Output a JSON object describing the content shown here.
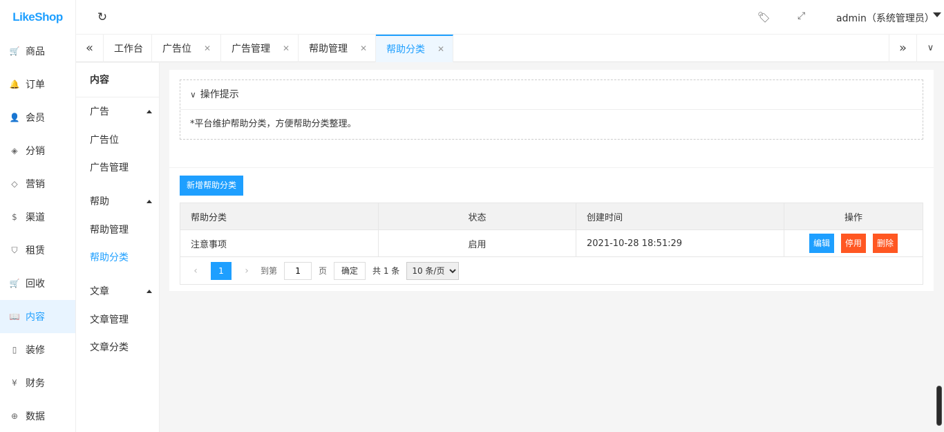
{
  "app": {
    "logo": "LikeShop"
  },
  "header": {
    "refresh_icon": "refresh-icon",
    "user_label": "admin（系统管理员）"
  },
  "nav": {
    "items": [
      {
        "label": "商品",
        "icon": "cart-icon",
        "glyph": "🛒"
      },
      {
        "label": "订单",
        "icon": "bell-icon",
        "glyph": "🔔"
      },
      {
        "label": "会员",
        "icon": "user-icon",
        "glyph": "👤"
      },
      {
        "label": "分销",
        "icon": "layers-icon",
        "glyph": "◈"
      },
      {
        "label": "营销",
        "icon": "diamond-icon",
        "glyph": "◇"
      },
      {
        "label": "渠道",
        "icon": "dollar-icon",
        "glyph": "$"
      },
      {
        "label": "租赁",
        "icon": "shield-icon",
        "glyph": "⛉"
      },
      {
        "label": "回收",
        "icon": "cart-icon",
        "glyph": "🛒"
      },
      {
        "label": "内容",
        "icon": "book-icon",
        "glyph": "📖",
        "active": true
      },
      {
        "label": "装修",
        "icon": "tablet-icon",
        "glyph": "▯"
      },
      {
        "label": "财务",
        "icon": "yen-icon",
        "glyph": "¥"
      },
      {
        "label": "数据",
        "icon": "globe-icon",
        "glyph": "⊕"
      }
    ]
  },
  "tabs": {
    "items": [
      {
        "label": "工作台"
      },
      {
        "label": "广告位"
      },
      {
        "label": "广告管理"
      },
      {
        "label": "帮助管理"
      },
      {
        "label": "帮助分类",
        "active": true
      }
    ]
  },
  "subnav": {
    "title": "内容",
    "groups": [
      {
        "label": "广告",
        "items": [
          "广告位",
          "广告管理"
        ]
      },
      {
        "label": "帮助",
        "items": [
          "帮助管理",
          "帮助分类"
        ]
      },
      {
        "label": "文章",
        "items": [
          "文章管理",
          "文章分类"
        ]
      }
    ]
  },
  "tips": {
    "title": "操作提示",
    "text": "*平台维护帮助分类，方便帮助分类整理。"
  },
  "toolbar": {
    "add_label": "新增帮助分类"
  },
  "table": {
    "headers": [
      "帮助分类",
      "状态",
      "创建时间",
      "操作"
    ],
    "rows": [
      {
        "name": "注意事项",
        "status": "启用",
        "created": "2021-10-28 18:51:29",
        "actions": {
          "edit": "编辑",
          "disable": "停用",
          "delete": "删除"
        }
      }
    ]
  },
  "pager": {
    "current": "1",
    "goto_label": "到第",
    "page_input": "1",
    "page_unit": "页",
    "confirm": "确定",
    "total": "共 1 条",
    "per_page": "10 条/页"
  },
  "colors": {
    "primary": "#1e9fff",
    "danger": "#ff5722"
  }
}
